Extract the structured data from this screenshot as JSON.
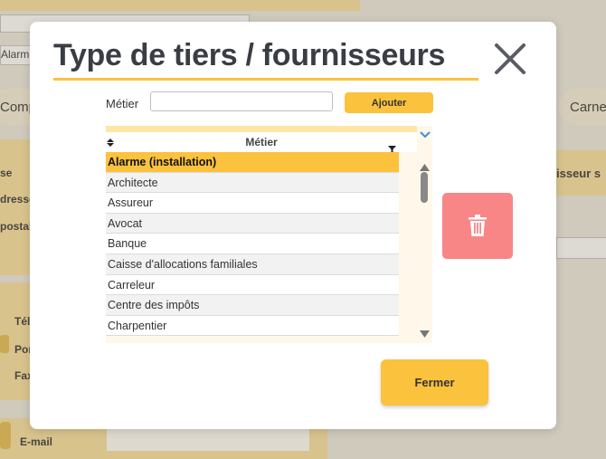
{
  "background": {
    "select_value": "Alarm",
    "tab_left": "Comp",
    "tab_right": "Carnet",
    "panel_right_label": "isseur s",
    "labels": [
      "se",
      "dresse",
      "postal"
    ],
    "contact_labels": [
      "Tél",
      "Por",
      "Fax"
    ],
    "email_label": "E-mail"
  },
  "modal": {
    "title": "Type de tiers / fournisseurs",
    "field_label": "Métier",
    "field_value": "",
    "add_button": "Ajouter",
    "table": {
      "column_header": "Métier",
      "rows": [
        "Alarme (installation)",
        "Architecte",
        "Assureur",
        "Avocat",
        "Banque",
        "Caisse d'allocations familiales",
        "Carreleur",
        "Centre des impôts",
        "Charpentier"
      ],
      "selected_index": 0
    },
    "close_button": "Fermer"
  },
  "colors": {
    "accent": "#fbc23d",
    "delete": "#f88686",
    "title": "#3b3d44"
  },
  "icons": [
    "close-icon",
    "sort-icon",
    "filter-icon",
    "chevron-down-icon",
    "trash-icon",
    "scroll-up-icon",
    "scroll-down-icon"
  ]
}
